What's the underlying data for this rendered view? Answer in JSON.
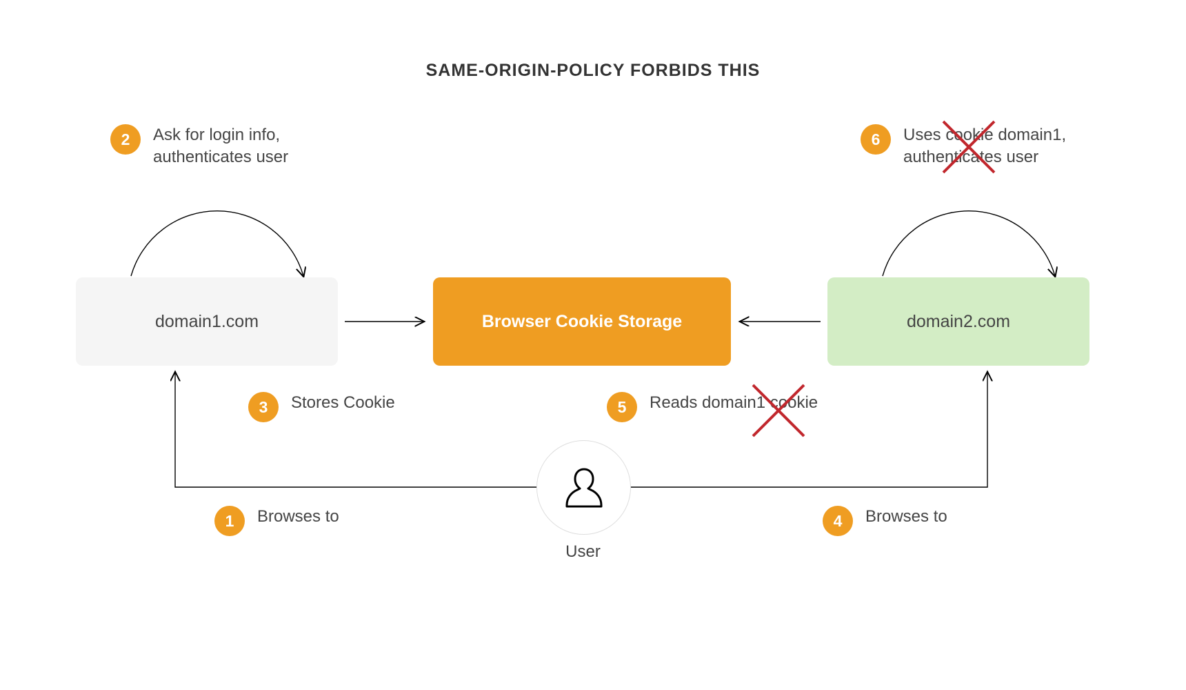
{
  "title": "SAME-ORIGIN-POLICY FORBIDS THIS",
  "boxes": {
    "domain1": "domain1.com",
    "storage": "Browser Cookie Storage",
    "domain2": "domain2.com"
  },
  "user": {
    "label": "User"
  },
  "steps": {
    "s1": {
      "num": "1",
      "text": "Browses to"
    },
    "s2": {
      "num": "2",
      "text": "Ask for login info, authenticates user"
    },
    "s3": {
      "num": "3",
      "text": "Stores Cookie"
    },
    "s4": {
      "num": "4",
      "text": "Browses to"
    },
    "s5": {
      "num": "5",
      "text": "Reads domain1 cookie"
    },
    "s6": {
      "num": "6",
      "text": "Uses cookie domain1, authenticates user"
    }
  },
  "colors": {
    "accent": "#ef9d22",
    "grey": "#f5f5f5",
    "green": "#d3edc5",
    "cross": "#c1272d"
  }
}
